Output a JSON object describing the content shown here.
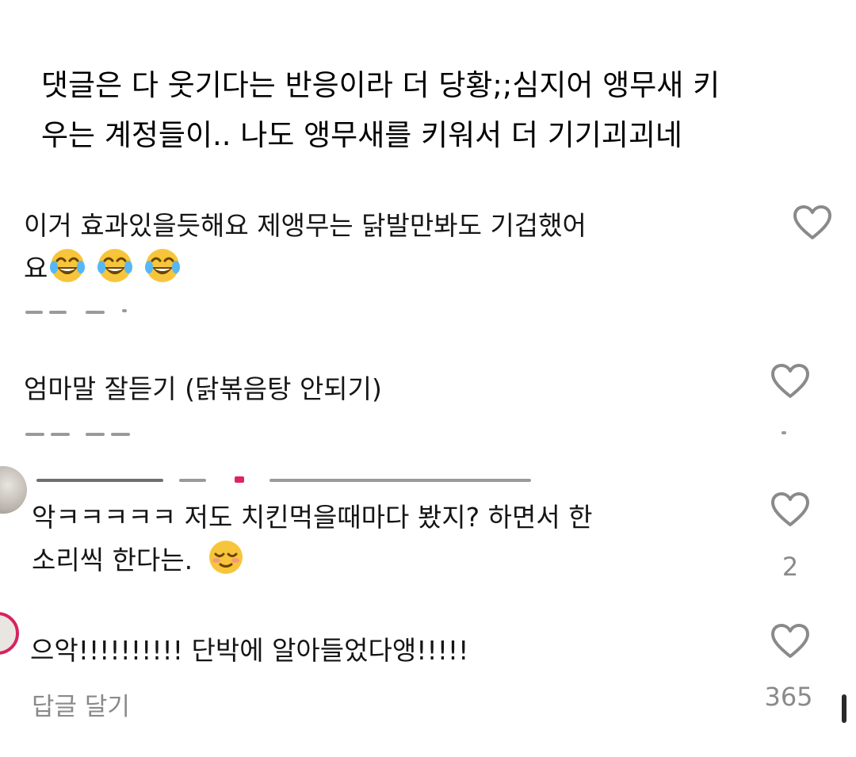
{
  "caption": {
    "line1": "댓글은 다 웃기다는 반응이라 더 당황;;심지어 앵무새 키",
    "line2": "우는 계정들이.. 나도 앵무새를 키워서 더 기기괴괴네"
  },
  "comments": [
    {
      "line1": "이거 효과있을듯해요 제앵무는 닭발만봐도 기겁했어",
      "line2": "요",
      "emojis": [
        "face-with-tears-of-joy",
        "face-with-tears-of-joy",
        "face-with-tears-of-joy"
      ]
    },
    {
      "line1": "엄마말 잘듣기 (닭볶음탕 안되기)"
    },
    {
      "line1": "악ㅋㅋㅋㅋㅋ 저도 치킨먹을때마다 봤지? 하면서 한",
      "line2": "소리씩 한다는.",
      "emoji": "relieved-face",
      "like_count": "2"
    },
    {
      "line1": "으악!!!!!!!!!! 단박에 알아들었다앵!!!!!",
      "reply_label": "답글 달기",
      "like_count": "365"
    }
  ],
  "colors": {
    "text": "#151515",
    "muted": "#8a8a8a",
    "heart_outline": "#8a8a8a",
    "avatar_ring": "#d6245f"
  }
}
